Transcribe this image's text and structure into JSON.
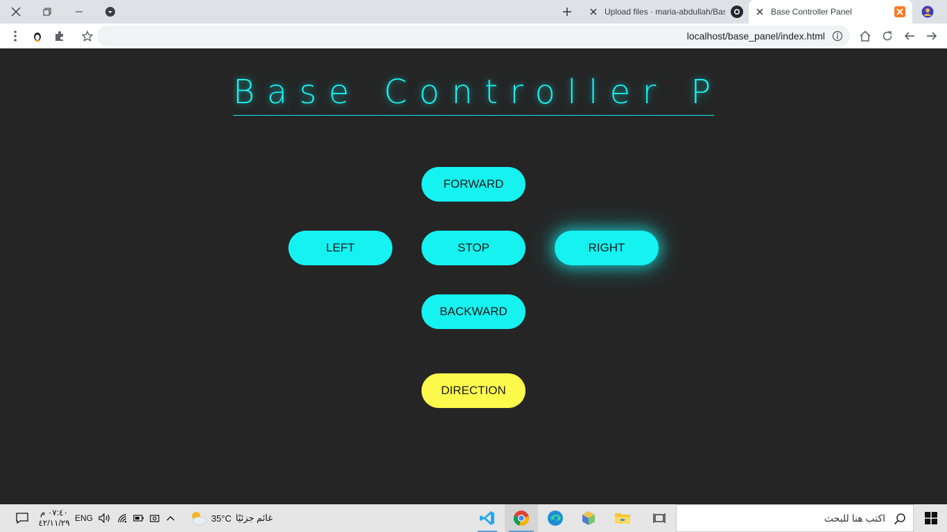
{
  "browser": {
    "tabs": [
      {
        "label": "Upload files · maria-abdullah/Bas",
        "icon": "github-icon"
      },
      {
        "label": "Base Controller Panel",
        "active": true
      }
    ],
    "url": "localhost/base_panel/index.html"
  },
  "page": {
    "title": "Base Controller Panel",
    "buttons": {
      "forward": "FORWARD",
      "left": "LEFT",
      "stop": "STOP",
      "right": "RIGHT",
      "backward": "BACKWARD",
      "direction": "DIRECTION"
    },
    "colors": {
      "accent": "#15f2f0",
      "direction": "#fdfa4c",
      "background": "#252525"
    }
  },
  "taskbar": {
    "search_placeholder": "اكتب هنا للبحث",
    "weather_temp": "35°C",
    "weather_text": "غائم جزئيًا",
    "language": "ENG",
    "time": "٠٧:٤٠ م",
    "date": "٤٢/١١/٢٩"
  }
}
